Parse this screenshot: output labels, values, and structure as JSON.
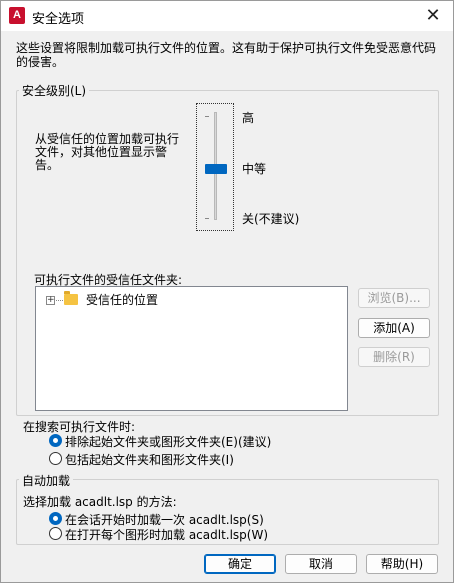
{
  "window": {
    "title": "安全选项",
    "icon_letter": "A",
    "close_glyph": "✕"
  },
  "intro_text": "这些设置将限制加载可执行文件的位置。这有助于保护可执行文件免受恶意代码的侵害。",
  "security_level": {
    "legend": "安全级别(L)",
    "description": "从受信任的位置加载可执行文件，对其他位置显示警告。",
    "levels": {
      "high": "高",
      "medium": "中等",
      "off": "关(不建议)"
    },
    "selected_level": "medium"
  },
  "trusted_folders": {
    "label": "可执行文件的受信任文件夹:",
    "tree_item": "受信任的位置",
    "expander": "+",
    "buttons": {
      "browse": "浏览(B)...",
      "add": "添加(A)",
      "delete": "删除(R)"
    }
  },
  "search_options": {
    "label": "在搜索可执行文件时:",
    "options": [
      {
        "label": "排除起始文件夹或图形文件夹(E)(建议)",
        "checked": true
      },
      {
        "label": "包括起始文件夹和图形文件夹(I)",
        "checked": false
      }
    ]
  },
  "autoload": {
    "legend": "自动加载",
    "label": "选择加载 acadlt.lsp 的方法:",
    "options": [
      {
        "label": "在会话开始时加载一次 acadlt.lsp(S)",
        "checked": true
      },
      {
        "label": "在打开每个图形时加载 acadlt.lsp(W)",
        "checked": false
      }
    ]
  },
  "footer": {
    "ok": "确定",
    "cancel": "取消",
    "help": "帮助(H)"
  },
  "colors": {
    "accent": "#0067c0",
    "app_icon": "#c8102e"
  }
}
